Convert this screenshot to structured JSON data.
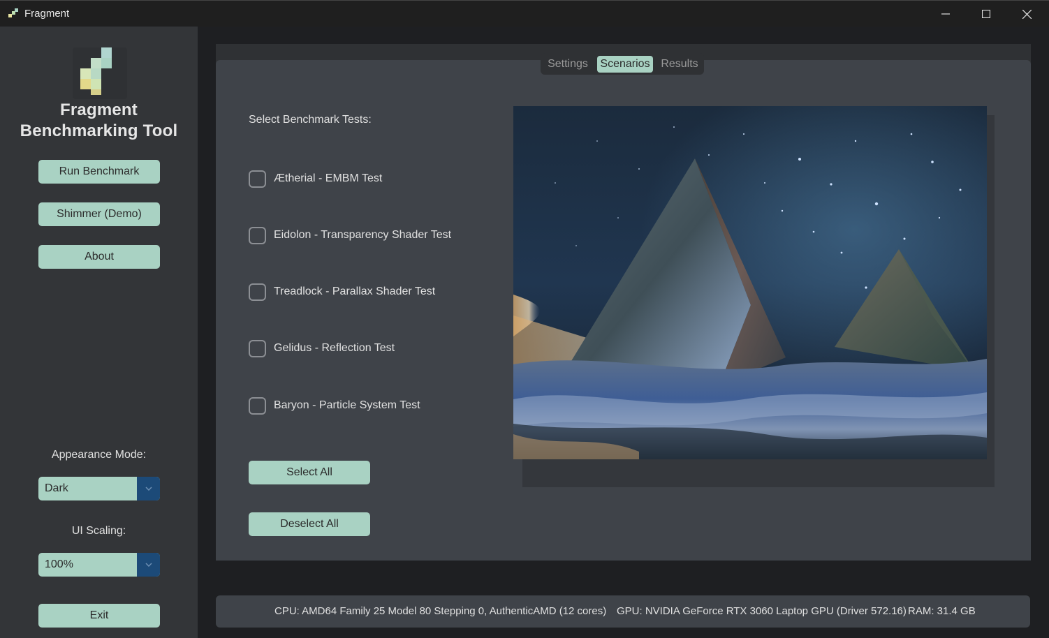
{
  "window": {
    "title": "Fragment"
  },
  "sidebar": {
    "app_title_line1": "Fragment",
    "app_title_line2": "Benchmarking Tool",
    "run_label": "Run Benchmark",
    "demo_label": "Shimmer (Demo)",
    "about_label": "About",
    "appearance_label": "Appearance Mode:",
    "appearance_value": "Dark",
    "scaling_label": "UI Scaling:",
    "scaling_value": "100%",
    "exit_label": "Exit"
  },
  "tabs": [
    {
      "label": "Settings",
      "active": false
    },
    {
      "label": "Scenarios",
      "active": true
    },
    {
      "label": "Results",
      "active": false
    }
  ],
  "scenarios": {
    "heading": "Select Benchmark Tests:",
    "tests": [
      {
        "label": "Ætherial - EMBM Test",
        "checked": false
      },
      {
        "label": "Eidolon - Transparency Shader Test",
        "checked": false
      },
      {
        "label": "Treadlock - Parallax Shader Test",
        "checked": false
      },
      {
        "label": "Gelidus - Reflection Test",
        "checked": false
      },
      {
        "label": "Baryon - Particle System Test",
        "checked": false
      }
    ],
    "select_all_label": "Select All",
    "deselect_all_label": "Deselect All"
  },
  "status": {
    "cpu": "CPU: AMD64 Family 25 Model 80 Stepping 0, AuthenticAMD (12 cores)",
    "gpu": "GPU: NVIDIA GeForce RTX 3060 Laptop GPU (Driver 572.16)",
    "ram": "RAM: 31.4 GB"
  },
  "colors": {
    "accent": "#a9d2c3",
    "dropdown_arrow_bg": "#1c4a78",
    "sidebar_bg": "#333538",
    "panel_bg": "#3f4349"
  }
}
